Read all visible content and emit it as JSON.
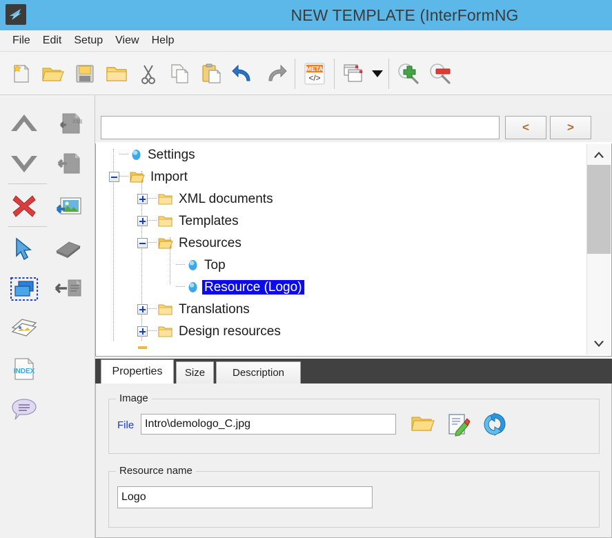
{
  "window": {
    "title": "NEW TEMPLATE (InterFormNG",
    "app_icon": "interformng-logo-icon",
    "titlebar_color": "#5cb8e8"
  },
  "menubar": {
    "items": [
      {
        "label": "File"
      },
      {
        "label": "Edit"
      },
      {
        "label": "Setup"
      },
      {
        "label": "View"
      },
      {
        "label": "Help"
      }
    ]
  },
  "toolbar": {
    "buttons": [
      {
        "name": "new-document-button",
        "icon": "new-document-icon",
        "tooltip": "New"
      },
      {
        "name": "open-folder-button",
        "icon": "open-folder-icon",
        "tooltip": "Open"
      },
      {
        "name": "save-button",
        "icon": "floppy-disk-save-icon",
        "tooltip": "Save"
      },
      {
        "name": "folder-button",
        "icon": "folder-icon",
        "tooltip": "Folder"
      },
      {
        "name": "cut-button",
        "icon": "scissors-cut-icon",
        "tooltip": "Cut"
      },
      {
        "name": "copy-button",
        "icon": "copy-pages-icon",
        "tooltip": "Copy"
      },
      {
        "name": "paste-button",
        "icon": "clipboard-paste-icon",
        "tooltip": "Paste"
      },
      {
        "name": "undo-button",
        "icon": "undo-arrow-icon",
        "tooltip": "Undo"
      },
      {
        "name": "redo-button",
        "icon": "redo-arrow-icon",
        "tooltip": "Redo"
      },
      {
        "name": "meta-code-button",
        "icon": "meta-code-icon",
        "tooltip": "META"
      },
      {
        "name": "windows-button",
        "icon": "cascade-windows-icon",
        "tooltip": "Windows"
      },
      {
        "name": "windows-dropdown-button",
        "icon": "caret-down-icon",
        "tooltip": "More windows"
      },
      {
        "name": "zoom-in-button",
        "icon": "magnifier-plus-icon",
        "tooltip": "Zoom in"
      },
      {
        "name": "zoom-out-button",
        "icon": "magnifier-minus-icon",
        "tooltip": "Zoom out"
      }
    ],
    "meta_label": "META",
    "meta_code": "</>"
  },
  "palette": {
    "buttons": [
      {
        "name": "move-up-button",
        "icon": "chevron-up-thick-icon"
      },
      {
        "name": "xml-input-button",
        "icon": "xml-document-in-icon"
      },
      {
        "name": "move-down-button",
        "icon": "chevron-down-thick-icon"
      },
      {
        "name": "document-in-button",
        "icon": "document-arrow-in-icon"
      },
      {
        "name": "delete-button",
        "icon": "red-x-delete-icon"
      },
      {
        "name": "insert-image-button",
        "icon": "image-insert-icon"
      },
      {
        "name": "select-pointer-button",
        "icon": "arrow-pointer-icon"
      },
      {
        "name": "book-button",
        "icon": "book-stack-icon"
      },
      {
        "name": "select-object-button",
        "icon": "selected-layers-icon"
      },
      {
        "name": "text-in-button",
        "icon": "text-arrow-left-icon"
      },
      {
        "name": "overlay-button",
        "icon": "layered-pages-icon"
      },
      {
        "name": "index-button",
        "icon": "index-document-icon"
      },
      {
        "name": "comment-button",
        "icon": "speech-bubble-icon"
      }
    ],
    "index_label": "INDEX"
  },
  "tree": {
    "search_value": "",
    "search_placeholder": "",
    "prev_label": "<",
    "next_label": ">",
    "scroll_up_label": "˄",
    "scroll_down_label": "˅",
    "nodes": [
      {
        "label": "Settings",
        "depth": 0,
        "icon": "blue-sphere-icon",
        "expander": "none"
      },
      {
        "label": "Import",
        "depth": 0,
        "icon": "open-folder-icon",
        "expander": "minus"
      },
      {
        "label": "XML documents",
        "depth": 1,
        "icon": "closed-folder-icon",
        "expander": "plus"
      },
      {
        "label": "Templates",
        "depth": 1,
        "icon": "closed-folder-icon",
        "expander": "plus"
      },
      {
        "label": "Resources",
        "depth": 1,
        "icon": "open-folder-icon",
        "expander": "minus"
      },
      {
        "label": "Top",
        "depth": 2,
        "icon": "blue-sphere-icon",
        "expander": "none"
      },
      {
        "label": "Resource (Logo)",
        "depth": 2,
        "icon": "blue-sphere-icon",
        "expander": "none",
        "selected": true
      },
      {
        "label": "Translations",
        "depth": 1,
        "icon": "closed-folder-icon",
        "expander": "plus"
      },
      {
        "label": "Design resources",
        "depth": 1,
        "icon": "closed-folder-icon",
        "expander": "plus"
      }
    ]
  },
  "tabs": [
    {
      "label": "Properties",
      "active": true
    },
    {
      "label": "Size",
      "active": false
    },
    {
      "label": "Description",
      "active": false
    }
  ],
  "properties": {
    "image_group": {
      "title": "Image",
      "file_label": "File",
      "file_value": "Intro\\demologo_C.jpg",
      "browse_button": "browse-folder-button",
      "edit_button": "edit-document-button",
      "refresh_button": "refresh-reload-button"
    },
    "resource_group": {
      "title": "Resource name",
      "value": "Logo"
    }
  },
  "colors": {
    "titlebar": "#5cb8e8",
    "tabstrip": "#414141",
    "selection": "#0a0af0",
    "link_label": "#1b3ad6",
    "panel": "#f0f0f0"
  }
}
